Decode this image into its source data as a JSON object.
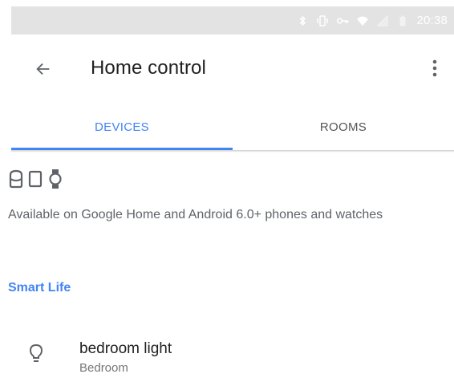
{
  "status_bar": {
    "time": "20:38",
    "icons": [
      "bluetooth-icon",
      "vibrate-icon",
      "vpn-key-icon",
      "wifi-icon",
      "signal-icon",
      "battery-icon"
    ]
  },
  "app_bar": {
    "title": "Home control",
    "back_icon": "arrow-back-icon",
    "menu_icon": "more-vert-icon"
  },
  "tabs": [
    {
      "label": "DEVICES",
      "active": true
    },
    {
      "label": "ROOMS",
      "active": false
    }
  ],
  "availability": {
    "icons": [
      "google-home-icon",
      "phone-icon",
      "watch-icon"
    ],
    "text": "Available on Google Home and Android 6.0+ phones and watches"
  },
  "section": {
    "title": "Smart Life"
  },
  "devices": [
    {
      "name": "bedroom light",
      "room": "Bedroom",
      "icon": "lightbulb-icon"
    }
  ],
  "colors": {
    "accent": "#4285f4",
    "status_bar": "#e3e3e3",
    "text_primary": "#212121",
    "text_secondary": "#757575"
  }
}
